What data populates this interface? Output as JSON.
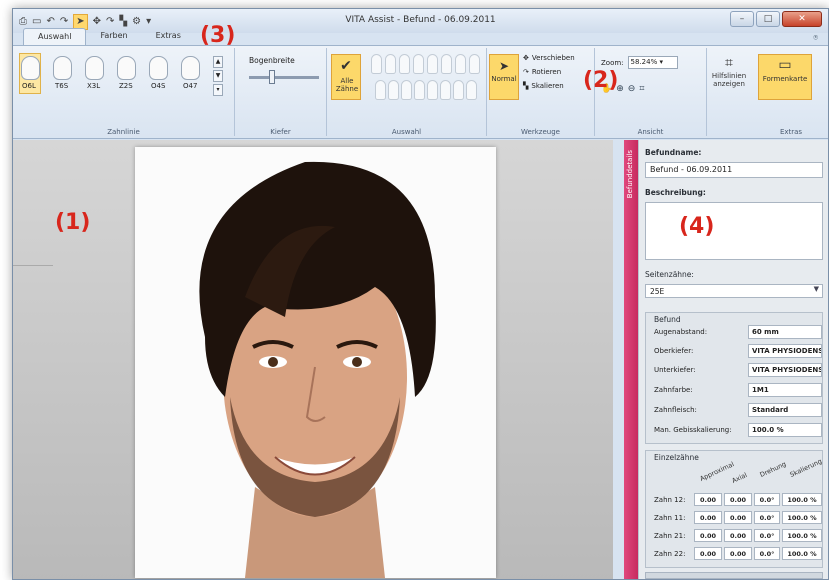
{
  "window": {
    "title": "VITA Assist - Befund - 06.09.2011",
    "min_label": "–",
    "max_label": "□",
    "close_label": "✕"
  },
  "qat": [
    "⎙",
    "▭",
    "↶",
    "↷",
    "➤",
    "✥",
    "↷",
    "▚",
    "⚙",
    "▾"
  ],
  "tabs": [
    "Auswahl",
    "Farben",
    "Extras"
  ],
  "help_icon": "⍟",
  "ribbon": {
    "zahnlinie": {
      "teeth": [
        "O6L",
        "T6S",
        "X3L",
        "Z2S",
        "O4S",
        "O47"
      ],
      "label": "Zahnlinie"
    },
    "kiefer": {
      "slider_label": "Bogenbreite",
      "label": "Kiefer"
    },
    "auswahl": {
      "all_button": "Alle Zähne",
      "label": "Auswahl"
    },
    "werkzeuge": {
      "normal": "Normal",
      "tools": [
        "Verschieben",
        "Rotieren",
        "Skalieren"
      ],
      "label": "Werkzeuge"
    },
    "ansicht": {
      "zoom_label": "Zoom:",
      "zoom_value": "58.24%",
      "hilfslinien": "Hilfslinien anzeigen",
      "label": "Ansicht"
    },
    "extras": {
      "formenkarte": "Formenkarte",
      "label": "Extras"
    }
  },
  "annotations": [
    "(1)",
    "(2)",
    "(3)",
    "(4)"
  ],
  "panel": {
    "tab_title": "Befunddetails",
    "befundname_label": "Befundname:",
    "befundname_value": "Befund - 06.09.2011",
    "beschreibung_label": "Beschreibung:",
    "seitenzaehne_label": "Seitenzähne:",
    "seitenzaehne_value": "25E",
    "befund_section": "Befund",
    "fields": [
      {
        "k": "Augenabstand:",
        "v": "60  mm"
      },
      {
        "k": "Oberkiefer:",
        "v": "VITA PHYSIODENS"
      },
      {
        "k": "Unterkiefer:",
        "v": "VITA PHYSIODENS"
      },
      {
        "k": "Zahnfarbe:",
        "v": "1M1"
      },
      {
        "k": "Zahnfleisch:",
        "v": "Standard"
      },
      {
        "k": "Man. Gebisskalierung:",
        "v": "100.0 %"
      }
    ],
    "einzel_section": "Einzelzähne",
    "columns": [
      "Approximal",
      "Axial",
      "Drehung",
      "Skalierung"
    ],
    "rows": [
      {
        "k": "Zahn 12:",
        "vals": [
          "0.00",
          "0.00",
          "0.0°",
          "100.0 %"
        ]
      },
      {
        "k": "Zahn 11:",
        "vals": [
          "0.00",
          "0.00",
          "0.0°",
          "100.0 %"
        ]
      },
      {
        "k": "Zahn 21:",
        "vals": [
          "0.00",
          "0.00",
          "0.0°",
          "100.0 %"
        ]
      },
      {
        "k": "Zahn 22:",
        "vals": [
          "0.00",
          "0.00",
          "0.0°",
          "100.0 %"
        ]
      }
    ]
  }
}
